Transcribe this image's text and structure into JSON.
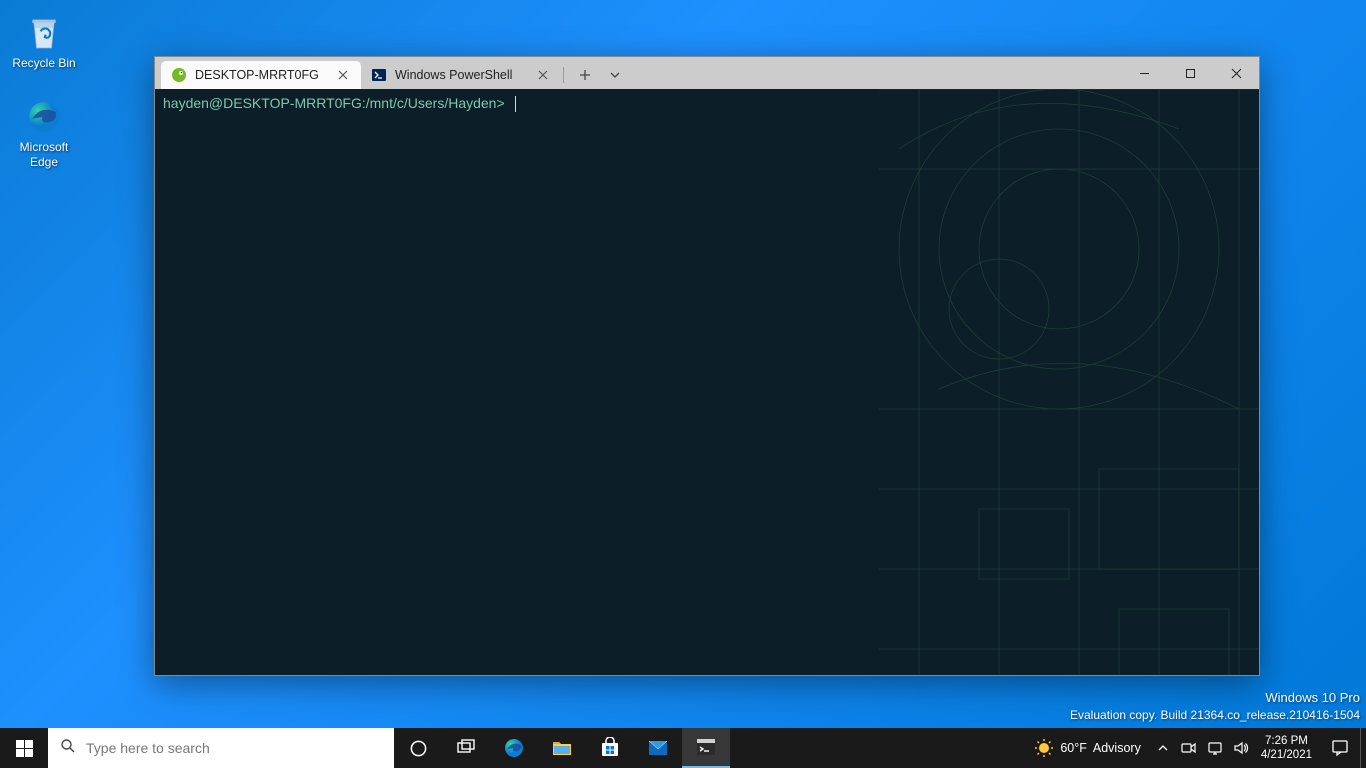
{
  "desktop": {
    "icons": [
      {
        "name": "recycle-bin",
        "label": "Recycle Bin"
      },
      {
        "name": "microsoft-edge",
        "label": "Microsoft\nEdge"
      }
    ]
  },
  "terminal": {
    "tabs": [
      {
        "title": "DESKTOP-MRRT0FG",
        "active": true,
        "icon": "opensuse"
      },
      {
        "title": "Windows PowerShell",
        "active": false,
        "icon": "powershell"
      }
    ],
    "prompt": "hayden@DESKTOP-MRRT0FG:/mnt/c/Users/Hayden>"
  },
  "watermark": {
    "line1": "Windows 10 Pro",
    "line2": "Evaluation copy. Build 21364.co_release.210416-1504"
  },
  "taskbar": {
    "search_placeholder": "Type here to search",
    "weather": {
      "temp": "60°F",
      "condition": "Advisory"
    },
    "clock": {
      "time": "7:26 PM",
      "date": "4/21/2021"
    }
  }
}
